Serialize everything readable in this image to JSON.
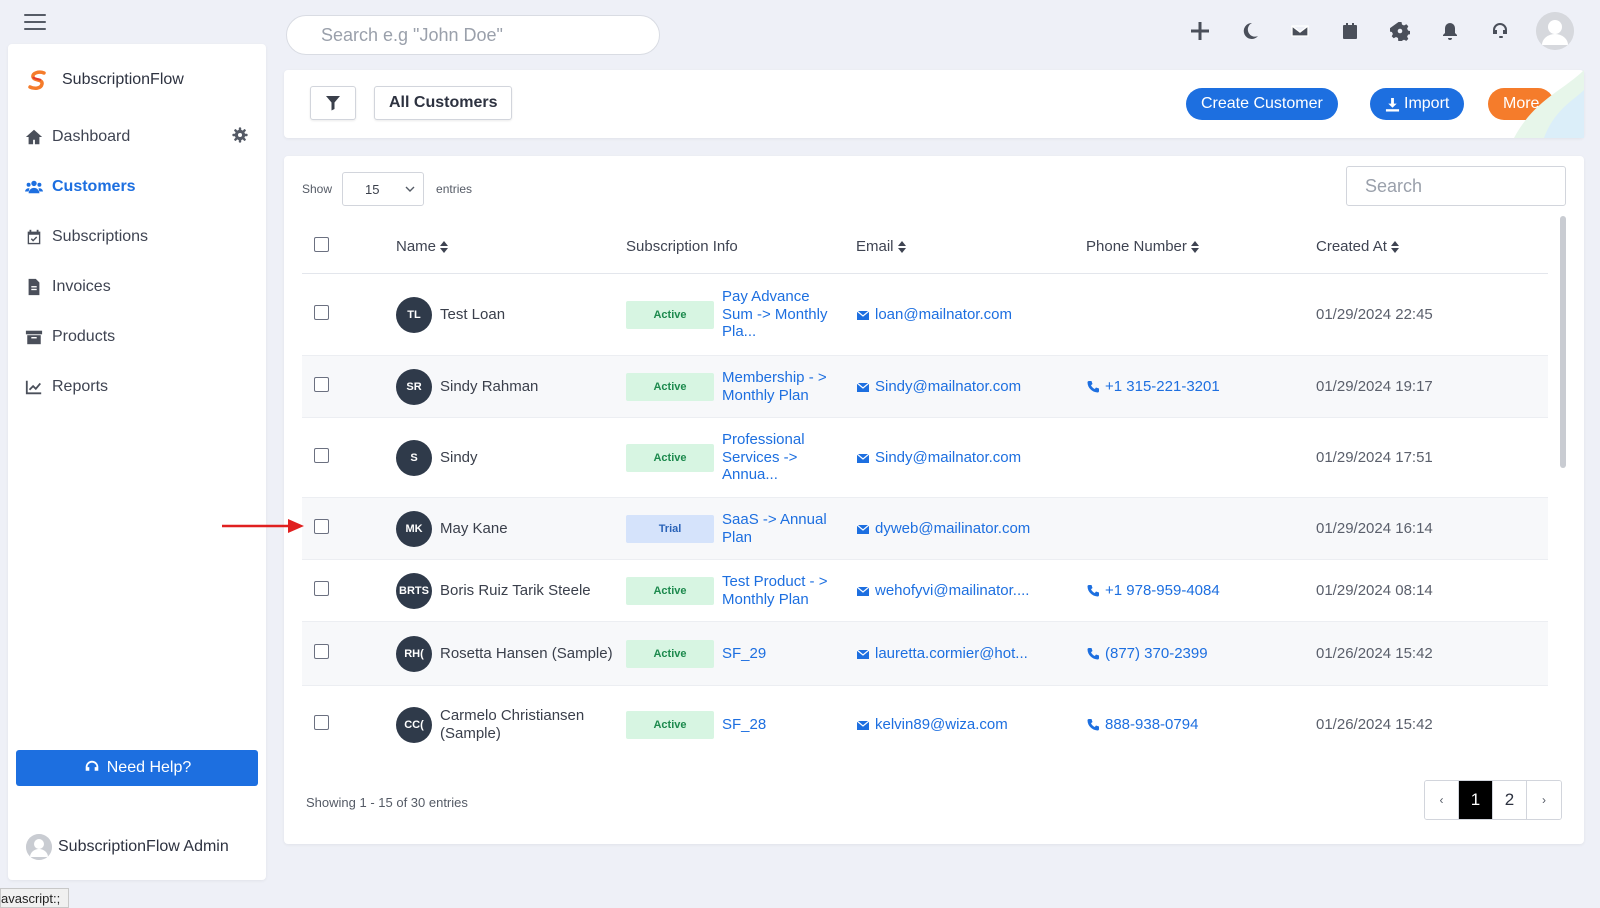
{
  "header": {
    "search_placeholder": "Search e.g \"John Doe\""
  },
  "top_icons": [
    "plus-icon",
    "moon-icon",
    "mail-icon",
    "calendar-icon",
    "gear-icon",
    "bell-icon",
    "headset-icon"
  ],
  "sidebar": {
    "brand": "SubscriptionFlow",
    "items": [
      {
        "label": "Dashboard",
        "icon": "home-icon"
      },
      {
        "label": "Customers",
        "icon": "users-icon",
        "active": true
      },
      {
        "label": "Subscriptions",
        "icon": "calendar-check-icon"
      },
      {
        "label": "Invoices",
        "icon": "invoice-icon"
      },
      {
        "label": "Products",
        "icon": "archive-icon"
      },
      {
        "label": "Reports",
        "icon": "chart-line-icon"
      }
    ],
    "help_label": "Need Help?",
    "admin_name": "SubscriptionFlow Admin"
  },
  "toolbar": {
    "filter_view": "All Customers",
    "create_label": "Create Customer",
    "import_label": "Import",
    "more_label": "More"
  },
  "table": {
    "show_label": "Show",
    "entries_label": "entries",
    "page_size": "15",
    "search_placeholder": "Search",
    "columns": [
      "Name",
      "Subscription Info",
      "Email",
      "Phone Number",
      "Created At"
    ],
    "rows": [
      {
        "initials": "TL",
        "name": "Test Loan",
        "status": "Active",
        "plan": "Pay Advance Sum -> Monthly Pla...",
        "email": "loan@mailnator.com",
        "phone": "",
        "created": "01/29/2024 22:45"
      },
      {
        "initials": "SR",
        "name": "Sindy Rahman",
        "status": "Active",
        "plan": "Membership - > Monthly Plan",
        "email": "Sindy@mailnator.com",
        "phone": "+1 315-221-3201",
        "created": "01/29/2024 19:17"
      },
      {
        "initials": "S",
        "name": "Sindy",
        "status": "Active",
        "plan": "Professional Services -> Annua...",
        "email": "Sindy@mailnator.com",
        "phone": "",
        "created": "01/29/2024 17:51"
      },
      {
        "initials": "MK",
        "name": "May Kane",
        "status": "Trial",
        "plan": "SaaS -> Annual Plan",
        "email": "dyweb@mailinator.com",
        "phone": "",
        "created": "01/29/2024 16:14"
      },
      {
        "initials": "BRTS",
        "name": "Boris Ruiz Tarik Steele",
        "status": "Active",
        "plan": "Test Product - > Monthly Plan",
        "email": "wehofyvi@mailinator....",
        "phone": "+1 978-959-4084",
        "created": "01/29/2024 08:14"
      },
      {
        "initials": "RH(",
        "name": "Rosetta Hansen (Sample)",
        "status": "Active",
        "plan": "SF_29",
        "email": "lauretta.cormier@hot...",
        "phone": "(877) 370-2399",
        "created": "01/26/2024 15:42"
      },
      {
        "initials": "CC(",
        "name": "Carmelo Christiansen (Sample)",
        "status": "Active",
        "plan": "SF_28",
        "email": "kelvin89@wiza.com",
        "phone": "888-938-0794",
        "created": "01/26/2024 15:42"
      }
    ],
    "footer_info": "Showing 1 - 15 of 30 entries",
    "pagination": {
      "prev": "‹",
      "pages": [
        "1",
        "2"
      ],
      "current": "1",
      "next": "›"
    }
  },
  "status_bar": "avascript:;",
  "colors": {
    "primary": "#1d6fe0",
    "more": "#f57c2b",
    "active_badge_bg": "#d7f5e2",
    "trial_badge_bg": "#d5e3fb",
    "annotation_arrow": "#e02020"
  }
}
